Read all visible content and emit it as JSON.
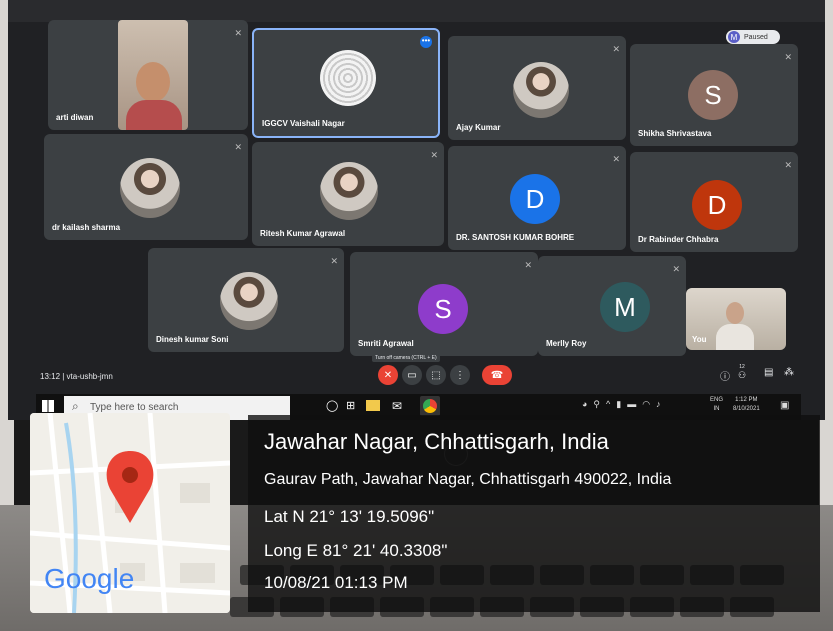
{
  "meet": {
    "meeting_code": "13:12  |  vta-ushb-jmn",
    "tooltip": "Turn off camera (CTRL + E)",
    "profile_label": "Paused",
    "profile_initial": "M",
    "participants": [
      {
        "name": "arti diwan"
      },
      {
        "name": "IGGCV Vaishali Nagar"
      },
      {
        "name": "Ajay Kumar"
      },
      {
        "name": "Shikha Shrivastava",
        "initial": "S"
      },
      {
        "name": "dr kailash sharma"
      },
      {
        "name": "Ritesh Kumar Agrawal"
      },
      {
        "name": "DR. SANTOSH KUMAR BOHRE",
        "initial": "D"
      },
      {
        "name": "Dr Rabinder Chhabra",
        "initial": "D"
      },
      {
        "name": "Dinesh kumar Soni"
      },
      {
        "name": "Smriti Agrawal",
        "initial": "S"
      },
      {
        "name": "Merlly Roy",
        "initial": "M"
      },
      {
        "name": "You"
      }
    ],
    "people_count": "12"
  },
  "taskbar": {
    "search_placeholder": "Type here to search",
    "lang": "ENG",
    "lang_sub": "IN",
    "time": "1:12 PM",
    "date": "8/10/2021"
  },
  "geotag": {
    "place": "Jawahar Nagar, Chhattisgarh, India",
    "address": "Gaurav Path, Jawahar Nagar, Chhattisgarh 490022, India",
    "lat": "Lat N 21° 13' 19.5096\"",
    "long": "Long E 81° 21' 40.3308\"",
    "datetime": "10/08/21 01:13 PM",
    "map_brand": "Google"
  },
  "colors": {
    "avatar_shikha": "#8d6e63",
    "avatar_santosh": "#1a73e8",
    "avatar_rabinder": "#bf360c",
    "avatar_smriti": "#8e3ccb",
    "avatar_merlly": "#2e5a5e",
    "end_call": "#ea4335"
  }
}
